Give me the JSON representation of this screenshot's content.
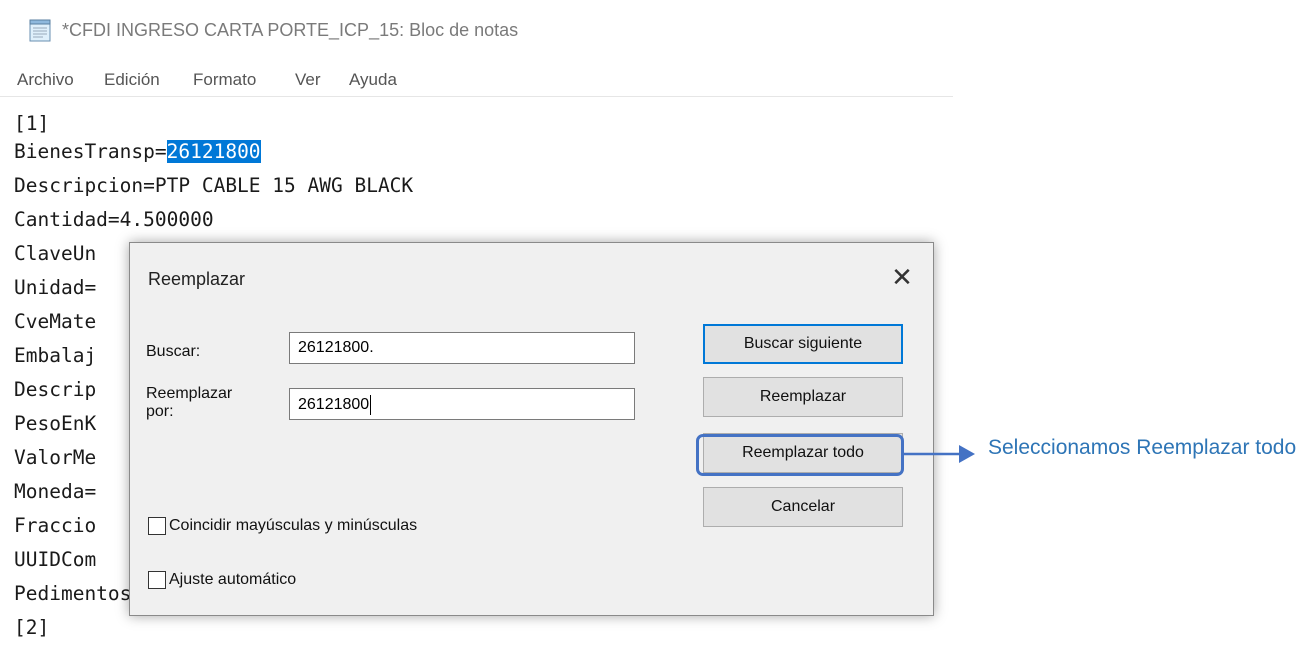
{
  "window": {
    "title": "*CFDI INGRESO CARTA PORTE_ICP_15: Bloc de notas"
  },
  "menu": {
    "items": [
      "Archivo",
      "Edición",
      "Formato",
      "Ver",
      "Ayuda"
    ]
  },
  "editor": {
    "lines": [
      "[1]",
      "BienesTransp=",
      "Descripcion=PTP CABLE 15 AWG BLACK",
      "Cantidad=4.500000",
      "ClaveUn",
      "Unidad=",
      "CveMate",
      "Embalaj",
      "Descrip",
      "PesoEnK",
      "ValorMe",
      "Moneda=",
      "Fraccio",
      "UUIDCom",
      "Pedimentos=",
      "[2]"
    ],
    "selected_text": "26121800"
  },
  "dialog": {
    "title": "Reemplazar",
    "close_glyph": "✕",
    "find_label": "Buscar:",
    "find_value": "26121800.",
    "replace_label_1": "Reemplazar",
    "replace_label_2": "por:",
    "replace_value": "26121800",
    "buttons": {
      "find_next": "Buscar siguiente",
      "replace": "Reemplazar",
      "replace_all": "Reemplazar todo",
      "cancel": "Cancelar"
    },
    "options": {
      "match_case": "Coincidir mayúsculas y minúsculas",
      "match_case_checked": false,
      "wrap_around": "Ajuste automático",
      "wrap_around_checked": false
    }
  },
  "annotation": {
    "text": "Seleccionamos Reemplazar todo",
    "color": "#2e75b6"
  }
}
